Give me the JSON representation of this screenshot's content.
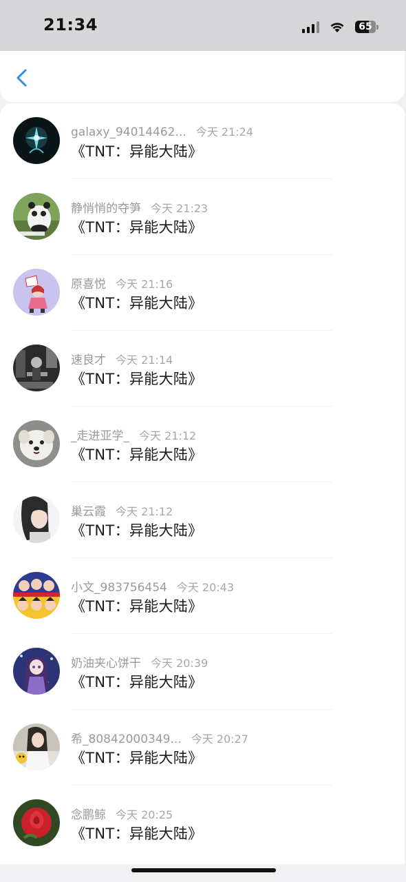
{
  "status_bar": {
    "time": "21:34",
    "battery": "65",
    "icons": [
      "signal-icon",
      "wifi-icon",
      "battery-icon"
    ]
  },
  "nav": {
    "back_icon": "chevron-left-icon",
    "accent_color": "#2f8fe6"
  },
  "items": [
    {
      "name": "galaxy_94014462...",
      "time": "今天 21:24",
      "title": "《TNT：异能大陆》"
    },
    {
      "name": "静悄悄的夺笋",
      "time": "今天 21:23",
      "title": "《TNT：异能大陆》"
    },
    {
      "name": "原喜悦",
      "time": "今天 21:16",
      "title": "《TNT：异能大陆》"
    },
    {
      "name": "速良才",
      "time": "今天 21:14",
      "title": "《TNT：异能大陆》"
    },
    {
      "name": "_走进亚学_",
      "time": "今天 21:12",
      "title": "《TNT：异能大陆》"
    },
    {
      "name": "巢云霞",
      "time": "今天 21:12",
      "title": "《TNT：异能大陆》"
    },
    {
      "name": "小文_983756454",
      "time": "今天 20:43",
      "title": "《TNT：异能大陆》"
    },
    {
      "name": "奶油夹心饼干",
      "time": "今天 20:39",
      "title": "《TNT：异能大陆》"
    },
    {
      "name": "希_80842000349...",
      "time": "今天 20:27",
      "title": "《TNT：异能大陆》"
    },
    {
      "name": "念鹏鲸",
      "time": "今天 20:25",
      "title": "《TNT：异能大陆》"
    }
  ]
}
